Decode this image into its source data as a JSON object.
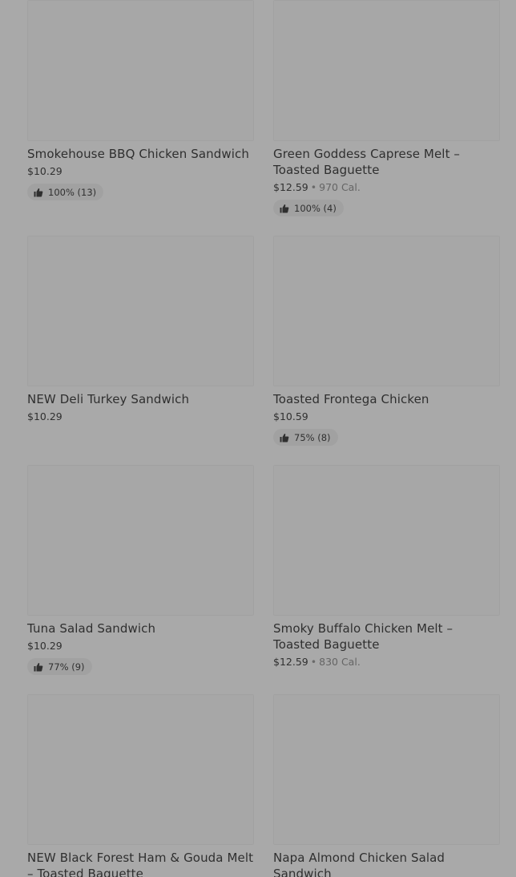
{
  "items": [
    {
      "name": "Smokehouse BBQ Chicken Sandwich",
      "price": "$10.29",
      "calories": "",
      "rating": "100% (13)"
    },
    {
      "name": "Green Goddess Caprese Melt – Toasted Baguette",
      "price": "$12.59",
      "calories": "970 Cal.",
      "rating": "100% (4)"
    },
    {
      "name": "NEW Deli Turkey Sandwich",
      "price": "$10.29",
      "calories": "",
      "rating": ""
    },
    {
      "name": "Toasted Frontega Chicken",
      "price": "$10.59",
      "calories": "",
      "rating": "75% (8)"
    },
    {
      "name": "Tuna Salad Sandwich",
      "price": "$10.29",
      "calories": "",
      "rating": "77% (9)"
    },
    {
      "name": "Smoky Buffalo Chicken Melt – Toasted Baguette",
      "price": "$12.59",
      "calories": "830 Cal.",
      "rating": ""
    },
    {
      "name": "NEW Black Forest Ham & Gouda Melt – Toasted Baguette",
      "price": "",
      "calories": "",
      "rating": ""
    },
    {
      "name": "Napa Almond Chicken Salad Sandwich",
      "price": "",
      "calories": "",
      "rating": ""
    }
  ],
  "separator": "•",
  "icons": {
    "rating": "thumbs-up-icon"
  }
}
